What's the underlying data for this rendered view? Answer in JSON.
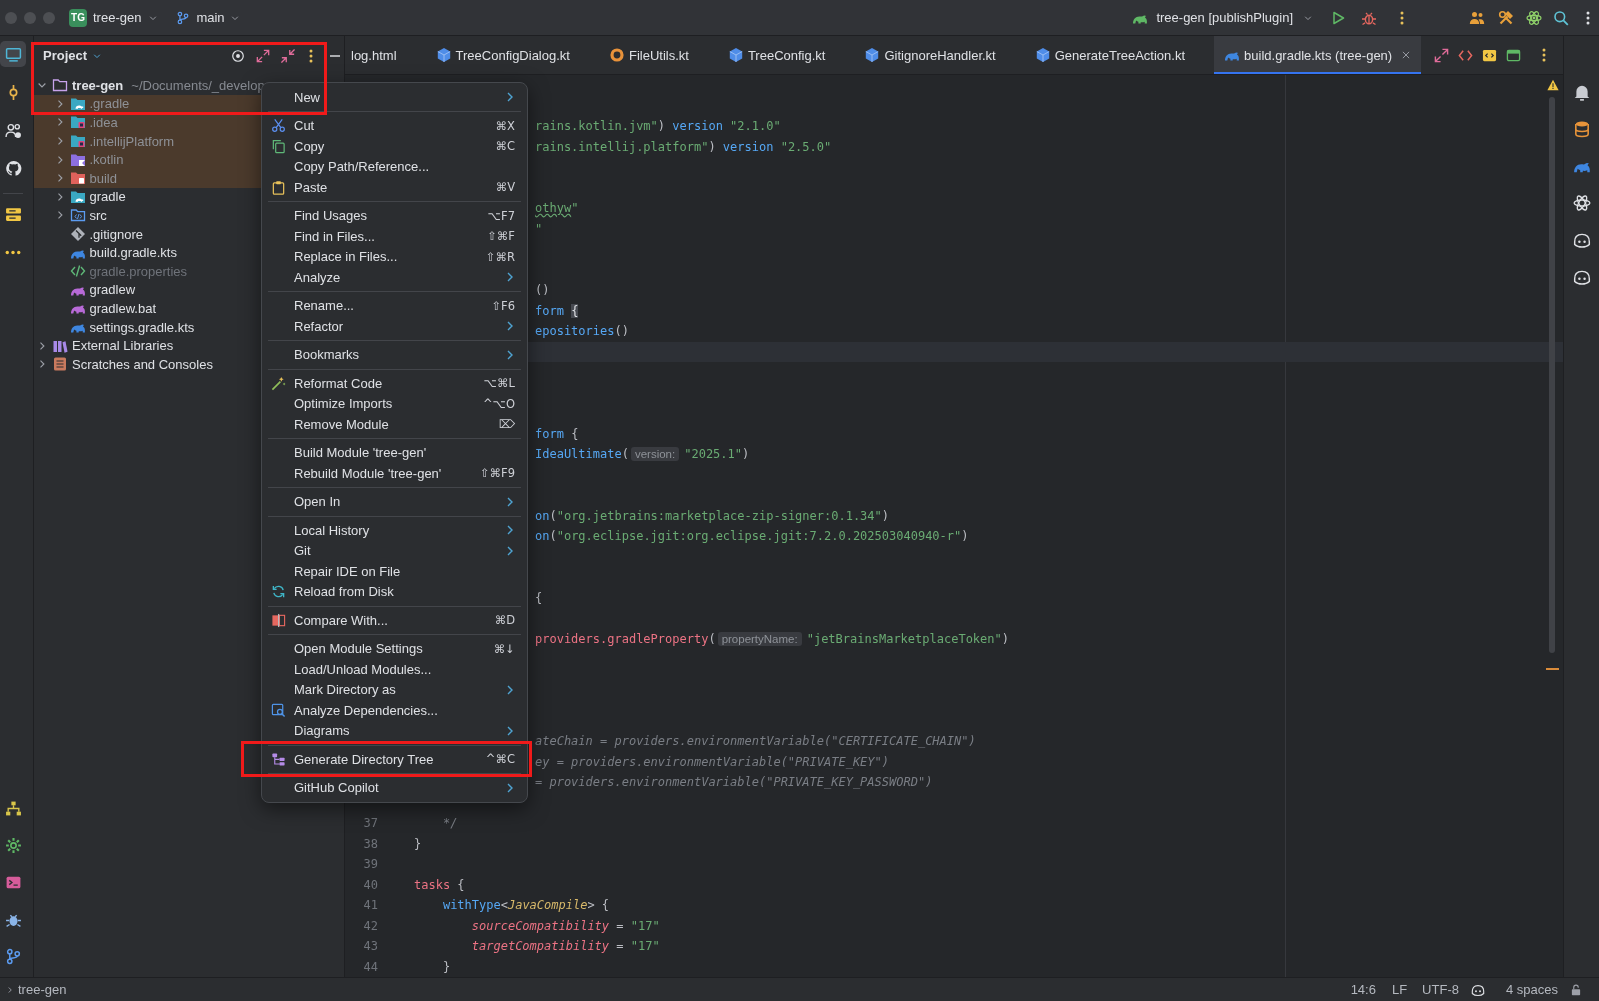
{
  "titlebar": {
    "project_badge": "TG",
    "project": "tree-gen",
    "branch": "main",
    "run_configuration": "tree-gen [publishPlugin]"
  },
  "left_toolbar": {
    "top": [
      {
        "kind": "project",
        "selected": true
      },
      {
        "kind": "commit",
        "selected": false
      },
      {
        "kind": "people",
        "selected": false
      },
      {
        "kind": "github",
        "selected": false
      },
      {
        "kind": "stack",
        "selected": false
      },
      {
        "kind": "more",
        "selected": false
      }
    ],
    "bottom": [
      {
        "kind": "hierarchy",
        "selected": false
      },
      {
        "kind": "gear",
        "selected": false
      },
      {
        "kind": "terminal",
        "selected": false
      },
      {
        "kind": "bug",
        "selected": false
      },
      {
        "kind": "branch",
        "selected": false
      }
    ]
  },
  "project_panel": {
    "title": "Project",
    "tree": [
      {
        "label": "tree-gen",
        "path": "~/Documents/_develop",
        "kind": "module",
        "excluded": false,
        "ignored": false,
        "expanded": true,
        "children": [
          {
            "label": ".gradle",
            "kind": "gradlefolder",
            "excluded": true,
            "ignored": false,
            "expanded": false
          },
          {
            "label": ".idea",
            "kind": "ideafolder",
            "excluded": true,
            "ignored": false,
            "expanded": false
          },
          {
            "label": ".intellijPlatform",
            "kind": "ideafolder",
            "excluded": true,
            "ignored": false,
            "expanded": false
          },
          {
            "label": ".kotlin",
            "kind": "kotlinfolder",
            "excluded": true,
            "ignored": false,
            "expanded": false
          },
          {
            "label": "build",
            "kind": "buildfolder",
            "excluded": true,
            "ignored": false,
            "expanded": false
          },
          {
            "label": "gradle",
            "kind": "gradlefolder",
            "excluded": false,
            "ignored": false,
            "expanded": false
          },
          {
            "label": "src",
            "kind": "sourcefolder",
            "excluded": false,
            "ignored": false,
            "expanded": false
          },
          {
            "label": ".gitignore",
            "kind": "gitignore",
            "excluded": false,
            "ignored": false
          },
          {
            "label": "build.gradle.kts",
            "kind": "gradlescript",
            "excluded": false,
            "ignored": false
          },
          {
            "label": "gradle.properties",
            "kind": "properties",
            "excluded": false,
            "ignored": true
          },
          {
            "label": "gradlew",
            "kind": "gradlew",
            "excluded": false,
            "ignored": false
          },
          {
            "label": "gradlew.bat",
            "kind": "gradlew",
            "excluded": false,
            "ignored": false
          },
          {
            "label": "settings.gradle.kts",
            "kind": "gradlescript",
            "excluded": false,
            "ignored": false
          }
        ]
      },
      {
        "label": "External Libraries",
        "kind": "libraries",
        "excluded": false,
        "ignored": false,
        "expanded": false
      },
      {
        "label": "Scratches and Consoles",
        "kind": "scratches",
        "excluded": false,
        "ignored": false,
        "expanded": false
      }
    ]
  },
  "tabs": [
    {
      "label": "log.html",
      "kind": "clipped",
      "selected": false
    },
    {
      "label": "TreeConfigDialog.kt",
      "kind": "class",
      "selected": false
    },
    {
      "label": "FileUtils.kt",
      "kind": "object",
      "selected": false
    },
    {
      "label": "TreeConfig.kt",
      "kind": "class",
      "selected": false
    },
    {
      "label": "GitignoreHandler.kt",
      "kind": "class",
      "selected": false
    },
    {
      "label": "GenerateTreeAction.kt",
      "kind": "class",
      "selected": false
    },
    {
      "label": "build.gradle.kts (tree-gen)",
      "kind": "gradle",
      "selected": true
    }
  ],
  "editor": {
    "lines": [
      {
        "kind": "blank",
        "current": false
      },
      {
        "kind": "blank",
        "current": false
      },
      {
        "kind": "clipped",
        "current": false,
        "tokens": [
          {
            "kind": "string",
            "text": "rains.kotlin.jvm\""
          },
          {
            "kind": "plain",
            "text": ")"
          },
          {
            "kind": "call",
            "text": " version"
          },
          {
            "kind": "string",
            "text": " \"2.1.0\""
          }
        ]
      },
      {
        "kind": "clipped",
        "current": false,
        "tokens": [
          {
            "kind": "string",
            "text": "rains.intellij.platform\""
          },
          {
            "kind": "plain",
            "text": ")"
          },
          {
            "kind": "call",
            "text": " version"
          },
          {
            "kind": "string",
            "text": " \"2.5.0\""
          }
        ]
      },
      {
        "kind": "blank",
        "current": false
      },
      {
        "kind": "blank",
        "current": false
      },
      {
        "kind": "clipped",
        "current": false,
        "tokens": [
          {
            "kind": "misspelled",
            "text": "othyw"
          },
          {
            "kind": "string",
            "text": "\""
          }
        ]
      },
      {
        "kind": "clipped",
        "current": false,
        "tokens": [
          {
            "kind": "string",
            "text": "\""
          }
        ]
      },
      {
        "kind": "blank",
        "current": false
      },
      {
        "kind": "blank",
        "current": false
      },
      {
        "kind": "clipped",
        "current": false,
        "tokens": [
          {
            "kind": "plain",
            "text": "()"
          }
        ]
      },
      {
        "kind": "clipped",
        "current": false,
        "tokens": [
          {
            "kind": "call",
            "text": "form"
          },
          {
            "kind": "brace",
            "text": " {"
          }
        ]
      },
      {
        "kind": "clipped",
        "current": false,
        "tokens": [
          {
            "kind": "call",
            "text": "epositories"
          },
          {
            "kind": "plain",
            "text": "()"
          }
        ]
      },
      {
        "kind": "blank",
        "current": true
      },
      {
        "kind": "blank",
        "current": false
      },
      {
        "kind": "blank",
        "current": false
      },
      {
        "kind": "blank",
        "current": false
      },
      {
        "kind": "clipped",
        "current": false,
        "tokens": [
          {
            "kind": "call",
            "text": "form"
          },
          {
            "kind": "plain",
            "text": " {"
          }
        ]
      },
      {
        "kind": "clipped",
        "current": false,
        "tokens": [
          {
            "kind": "call",
            "text": "IdeaUltimate"
          },
          {
            "kind": "plain",
            "text": "("
          },
          {
            "kind": "hint",
            "text": "version:"
          },
          {
            "kind": "string",
            "text": "\"2025.1\""
          },
          {
            "kind": "plain",
            "text": ")"
          }
        ]
      },
      {
        "kind": "blank",
        "current": false
      },
      {
        "kind": "blank",
        "current": false
      },
      {
        "kind": "clipped",
        "current": false,
        "tokens": [
          {
            "kind": "call",
            "text": "on"
          },
          {
            "kind": "plain",
            "text": "("
          },
          {
            "kind": "string",
            "text": "\"org.jetbrains:marketplace-zip-signer:0.1.34\""
          },
          {
            "kind": "plain",
            "text": ")"
          }
        ]
      },
      {
        "kind": "clipped",
        "current": false,
        "tokens": [
          {
            "kind": "call",
            "text": "on"
          },
          {
            "kind": "plain",
            "text": "("
          },
          {
            "kind": "string",
            "text": "\"org.eclipse.jgit:org.eclipse.jgit:7.2.0.202503040940-r\""
          },
          {
            "kind": "plain",
            "text": ")"
          }
        ]
      },
      {
        "kind": "blank",
        "current": false
      },
      {
        "kind": "blank",
        "current": false
      },
      {
        "kind": "clipped",
        "current": false,
        "tokens": [
          {
            "kind": "plain",
            "text": "{"
          }
        ]
      },
      {
        "kind": "blank",
        "current": false
      },
      {
        "kind": "clipped",
        "current": false,
        "tokens": [
          {
            "kind": "member",
            "text": "providers.gradleProperty"
          },
          {
            "kind": "plain",
            "text": "("
          },
          {
            "kind": "hint",
            "text": "propertyName:"
          },
          {
            "kind": "string",
            "text": "\"jetBrainsMarketplaceToken\""
          },
          {
            "kind": "plain",
            "text": ")"
          }
        ]
      },
      {
        "kind": "blank",
        "current": false
      },
      {
        "kind": "blank",
        "current": false
      },
      {
        "kind": "blank",
        "current": false
      },
      {
        "kind": "blank",
        "current": false
      },
      {
        "kind": "clipped",
        "current": false,
        "tokens": [
          {
            "kind": "comment",
            "text": "ateChain = providers.environmentVariable(\"CERTIFICATE_CHAIN\")"
          }
        ]
      },
      {
        "kind": "clipped",
        "current": false,
        "tokens": [
          {
            "kind": "comment",
            "text": "ey = providers.environmentVariable(\"PRIVATE_KEY\")"
          }
        ]
      },
      {
        "kind": "clipped",
        "current": false,
        "tokens": [
          {
            "kind": "comment",
            "text": "= providers.environmentVariable(\"PRIVATE_KEY_PASSWORD\")"
          }
        ]
      },
      {
        "kind": "blank",
        "current": false
      },
      {
        "kind": "full",
        "number": "37",
        "current": false,
        "tokens": [
          {
            "kind": "comment",
            "text": "    */"
          }
        ]
      },
      {
        "kind": "full",
        "number": "38",
        "current": false,
        "tokens": [
          {
            "kind": "plain",
            "text": "}"
          }
        ]
      },
      {
        "kind": "full",
        "number": "39",
        "current": false
      },
      {
        "kind": "full",
        "number": "40",
        "current": false,
        "tokens": [
          {
            "kind": "member",
            "text": "tasks"
          },
          {
            "kind": "plain",
            "text": " {"
          }
        ]
      },
      {
        "kind": "full",
        "number": "41",
        "current": false,
        "tokens": [
          {
            "kind": "call",
            "text": "    withType"
          },
          {
            "kind": "plain",
            "text": "<"
          },
          {
            "kind": "type",
            "text": "JavaCompile"
          },
          {
            "kind": "plain",
            "text": "> {"
          }
        ]
      },
      {
        "kind": "full",
        "number": "42",
        "current": false,
        "tokens": [
          {
            "kind": "property",
            "text": "        sourceCompatibility"
          },
          {
            "kind": "plain",
            "text": " = "
          },
          {
            "kind": "string",
            "text": "\"17\""
          }
        ]
      },
      {
        "kind": "full",
        "number": "43",
        "current": false,
        "tokens": [
          {
            "kind": "property",
            "text": "        targetCompatibility"
          },
          {
            "kind": "plain",
            "text": " = "
          },
          {
            "kind": "string",
            "text": "\"17\""
          }
        ]
      },
      {
        "kind": "full",
        "number": "44",
        "current": false,
        "tokens": [
          {
            "kind": "plain",
            "text": "    }"
          }
        ]
      }
    ]
  },
  "context_menu": {
    "items": [
      {
        "kind": "plain",
        "label": "New",
        "submenu": true
      },
      {
        "kind": "separator"
      },
      {
        "kind": "scissors",
        "label": "Cut",
        "shortcut": "⌘X",
        "submenu": false
      },
      {
        "kind": "copy",
        "label": "Copy",
        "shortcut": "⌘C",
        "submenu": false
      },
      {
        "kind": "plain",
        "label": "Copy Path/Reference...",
        "submenu": false
      },
      {
        "kind": "clipboard",
        "label": "Paste",
        "shortcut": "⌘V",
        "submenu": false
      },
      {
        "kind": "separator"
      },
      {
        "kind": "plain",
        "label": "Find Usages",
        "shortcut": "⌥F7",
        "submenu": false
      },
      {
        "kind": "plain",
        "label": "Find in Files...",
        "shortcut": "⇧⌘F",
        "submenu": false
      },
      {
        "kind": "plain",
        "label": "Replace in Files...",
        "shortcut": "⇧⌘R",
        "submenu": false
      },
      {
        "kind": "plain",
        "label": "Analyze",
        "submenu": true
      },
      {
        "kind": "separator"
      },
      {
        "kind": "plain",
        "label": "Rename...",
        "shortcut": "⇧F6",
        "submenu": false
      },
      {
        "kind": "plain",
        "label": "Refactor",
        "submenu": true
      },
      {
        "kind": "separator"
      },
      {
        "kind": "plain",
        "label": "Bookmarks",
        "submenu": true
      },
      {
        "kind": "separator"
      },
      {
        "kind": "wand",
        "label": "Reformat Code",
        "shortcut": "⌥⌘L",
        "submenu": false
      },
      {
        "kind": "plain",
        "label": "Optimize Imports",
        "shortcut": "^⌥O",
        "submenu": false
      },
      {
        "kind": "plain",
        "label": "Remove Module",
        "shortcut": "⌦",
        "submenu": false
      },
      {
        "kind": "separator"
      },
      {
        "kind": "plain",
        "label": "Build Module 'tree-gen'",
        "submenu": false
      },
      {
        "kind": "plain",
        "label": "Rebuild Module 'tree-gen'",
        "shortcut": "⇧⌘F9",
        "submenu": false
      },
      {
        "kind": "separator"
      },
      {
        "kind": "plain",
        "label": "Open In",
        "submenu": true
      },
      {
        "kind": "separator"
      },
      {
        "kind": "plain",
        "label": "Local History",
        "submenu": true
      },
      {
        "kind": "plain",
        "label": "Git",
        "submenu": true
      },
      {
        "kind": "plain",
        "label": "Repair IDE on File",
        "submenu": false
      },
      {
        "kind": "reload",
        "label": "Reload from Disk",
        "submenu": false
      },
      {
        "kind": "separator"
      },
      {
        "kind": "compare",
        "label": "Compare With...",
        "shortcut": "⌘D",
        "submenu": false
      },
      {
        "kind": "separator"
      },
      {
        "kind": "plain",
        "label": "Open Module Settings",
        "shortcut": "⌘↓",
        "submenu": false
      },
      {
        "kind": "plain",
        "label": "Load/Unload Modules...",
        "submenu": false
      },
      {
        "kind": "plain",
        "label": "Mark Directory as",
        "submenu": true
      },
      {
        "kind": "dependencies",
        "label": "Analyze Dependencies...",
        "submenu": false
      },
      {
        "kind": "plain",
        "label": "Diagrams",
        "submenu": true
      },
      {
        "kind": "separator"
      },
      {
        "kind": "tree",
        "label": "Generate Directory Tree",
        "shortcut": "^⌘C",
        "submenu": false
      },
      {
        "kind": "separator"
      },
      {
        "kind": "plain",
        "label": "GitHub Copilot",
        "submenu": true
      }
    ]
  },
  "status_bar": {
    "breadcrumb": "tree-gen",
    "caret": "14:6",
    "line_separator": "LF",
    "encoding": "UTF-8",
    "indent": "4 spaces"
  }
}
